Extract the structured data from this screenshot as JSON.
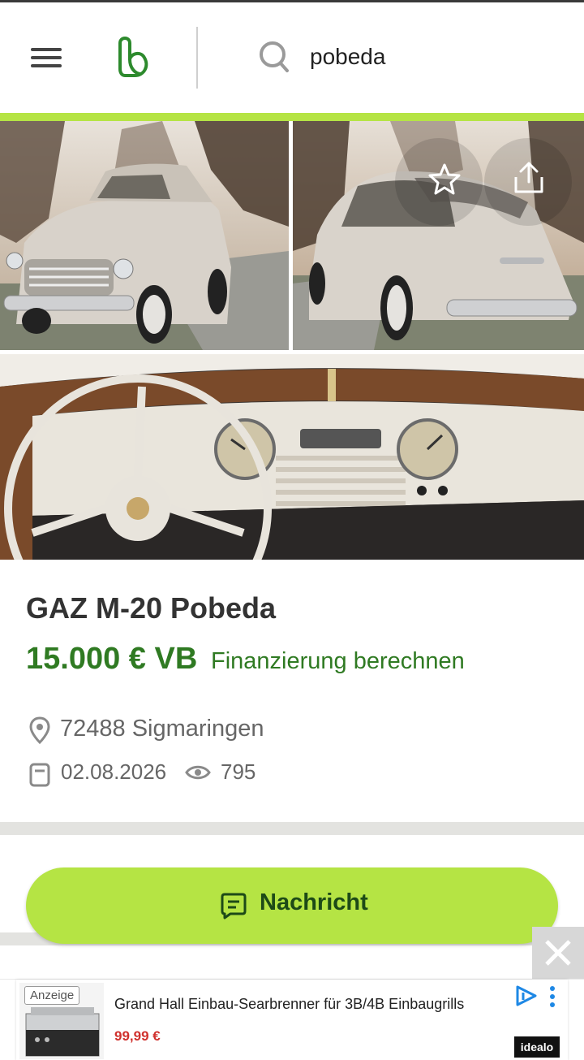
{
  "header": {
    "search_value": "pobeda",
    "icons": [
      "hamburger-menu-icon",
      "kleinanzeigen-logo",
      "search-icon"
    ]
  },
  "gallery": {
    "icons": [
      "star-icon",
      "share-icon"
    ]
  },
  "listing": {
    "title": "GAZ M-20 Pobeda",
    "price": "15.000 € VB",
    "finance_link": "Finanzierung berechnen",
    "location": "72488 Sigmaringen",
    "date": "02.08.2026",
    "views": "795"
  },
  "actions": {
    "message_label": "Nachricht"
  },
  "ad": {
    "badge": "Anzeige",
    "title": "Grand Hall Einbau-Searbrenner für 3B/4B Einbaugrills",
    "price": "99,99 €",
    "brand": "idealo"
  },
  "colors": {
    "accent_green": "#b5e444",
    "price_green": "#2f7a22",
    "button_text": "#1d4a17",
    "ad_price_red": "#d0312d"
  }
}
